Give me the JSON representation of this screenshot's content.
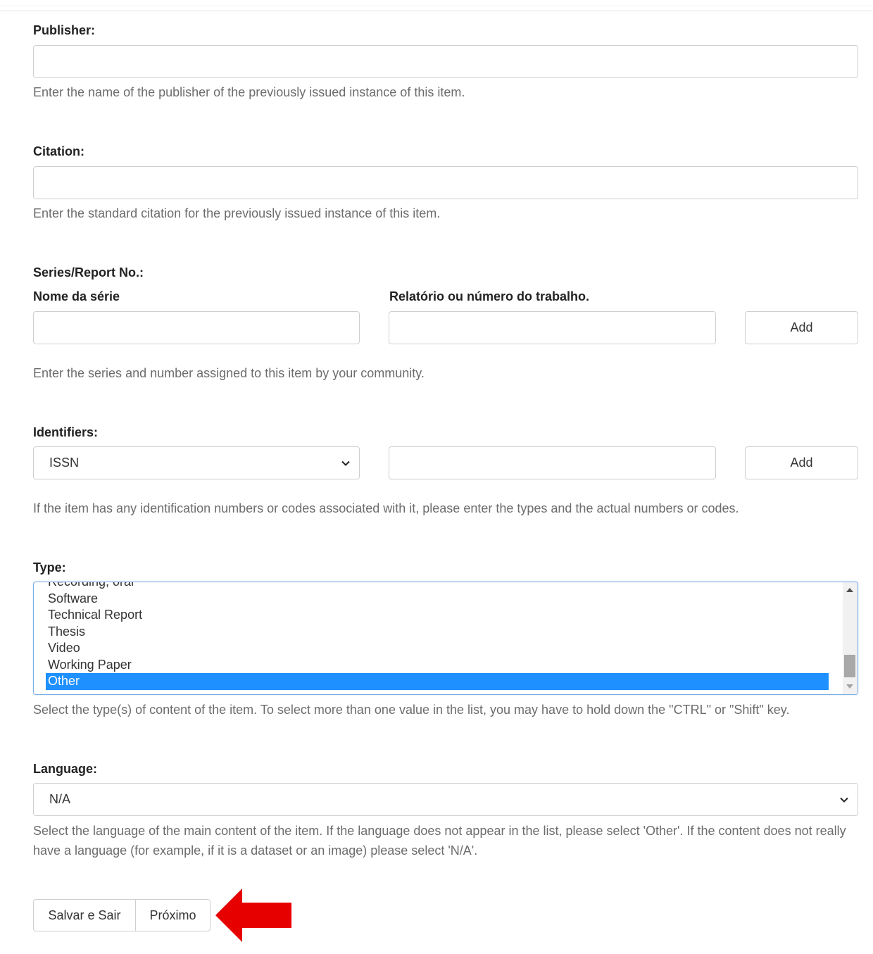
{
  "publisher": {
    "label": "Publisher:",
    "value": "",
    "help": "Enter the name of the publisher of the previously issued instance of this item."
  },
  "citation": {
    "label": "Citation:",
    "value": "",
    "help": "Enter the standard citation for the previously issued instance of this item."
  },
  "series": {
    "label": "Series/Report No.:",
    "name_label": "Nome da série",
    "number_label": "Relatório ou número do trabalho.",
    "add_label": "Add",
    "help": "Enter the series and number assigned to this item by your community."
  },
  "identifiers": {
    "label": "Identifiers:",
    "selected_type": "ISSN",
    "value": "",
    "add_label": "Add",
    "help": "If the item has any identification numbers or codes associated with it, please enter the types and the actual numbers or codes."
  },
  "type": {
    "label": "Type:",
    "options": [
      "Recording, oral",
      "Software",
      "Technical Report",
      "Thesis",
      "Video",
      "Working Paper",
      "Other"
    ],
    "selected": "Other",
    "help": "Select the type(s) of content of the item. To select more than one value in the list, you may have to hold down the \"CTRL\" or \"Shift\" key."
  },
  "language": {
    "label": "Language:",
    "selected": "N/A",
    "help": "Select the language of the main content of the item. If the language does not appear in the list, please select 'Other'. If the content does not really have a language (for example, if it is a dataset or an image) please select 'N/A'."
  },
  "actions": {
    "save_exit_label": "Salvar e Sair",
    "next_label": "Próximo"
  },
  "colors": {
    "selection": "#1e90ff",
    "arrow": "#e60000"
  }
}
